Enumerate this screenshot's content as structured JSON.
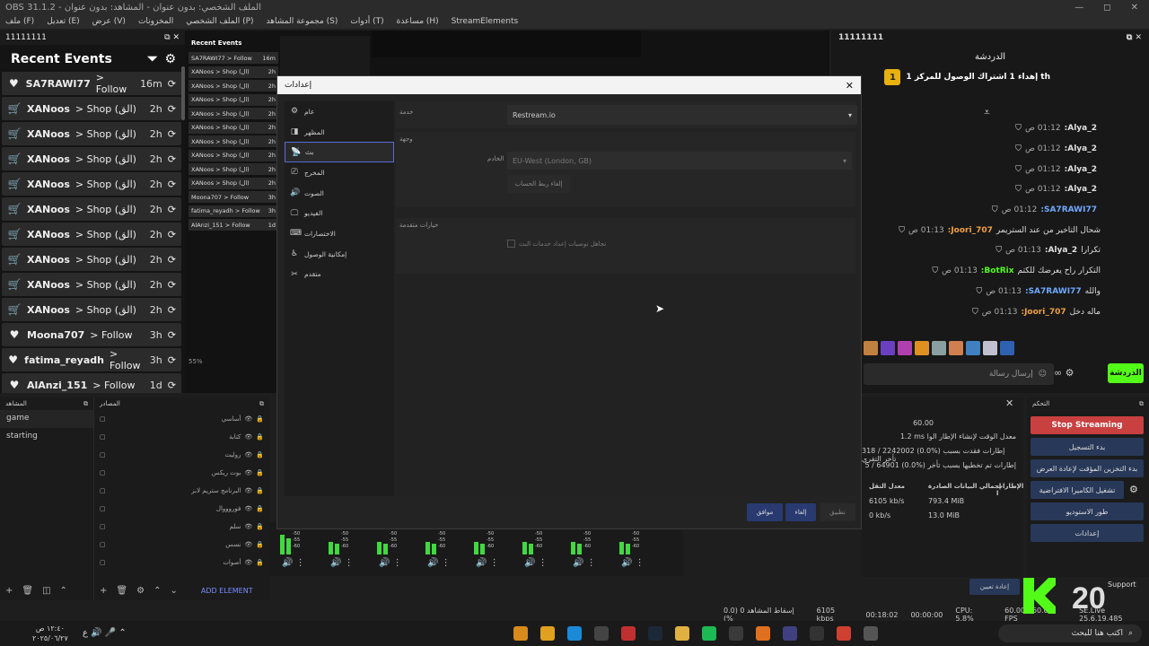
{
  "window": {
    "title": "OBS 31.1.2 - الملف الشخصي: بدون عنوان - المشاهد: بدون عنوان",
    "controls": [
      "—",
      "◻",
      "✕"
    ]
  },
  "menu": [
    "ملف (F)",
    "تعديل (E)",
    "عرض (V)",
    "المخزونات",
    "الملف الشخصي (P)",
    "مجموعة المشاهد (S)",
    "أدوات (T)",
    "مساعدة (H)",
    "StreamElements"
  ],
  "events_dock": {
    "tab_title": "11111111",
    "heading": "Recent Events",
    "rows": [
      {
        "name": "SA7RAWI77",
        "action": "> Follow",
        "time": "16m",
        "icon": "heart-icon"
      },
      {
        "name": "XANoos",
        "action": "> Shop (الق)",
        "time": "2h",
        "icon": "cart-icon"
      },
      {
        "name": "XANoos",
        "action": "> Shop (الق)",
        "time": "2h",
        "icon": "cart-icon"
      },
      {
        "name": "XANoos",
        "action": "> Shop (الق)",
        "time": "2h",
        "icon": "cart-icon"
      },
      {
        "name": "XANoos",
        "action": "> Shop (الق)",
        "time": "2h",
        "icon": "cart-icon"
      },
      {
        "name": "XANoos",
        "action": "> Shop (الق)",
        "time": "2h",
        "icon": "cart-icon"
      },
      {
        "name": "XANoos",
        "action": "> Shop (الق)",
        "time": "2h",
        "icon": "cart-icon"
      },
      {
        "name": "XANoos",
        "action": "> Shop (الق)",
        "time": "2h",
        "icon": "cart-icon"
      },
      {
        "name": "XANoos",
        "action": "> Shop (الق)",
        "time": "2h",
        "icon": "cart-icon"
      },
      {
        "name": "XANoos",
        "action": "> Shop (الق)",
        "time": "2h",
        "icon": "cart-icon"
      },
      {
        "name": "Moona707",
        "action": "> Follow",
        "time": "3h",
        "icon": "heart-icon"
      },
      {
        "name": "fatima_reyadh",
        "action": "> Follow",
        "time": "3h",
        "icon": "heart-icon"
      },
      {
        "name": "AlAnzi_151",
        "action": "> Follow",
        "time": "1d",
        "icon": "heart-icon"
      }
    ]
  },
  "preview": {
    "mini_title": "Recent Events",
    "mini_rows": [
      {
        "name": "SA7RAWI77 > Follow",
        "time": "16m"
      },
      {
        "name": "XANoos > Shop (ال)",
        "time": "2h"
      },
      {
        "name": "XANoos > Shop (ال)",
        "time": "2h"
      },
      {
        "name": "XANoos > Shop (ال)",
        "time": "2h"
      },
      {
        "name": "XANoos > Shop (ال)",
        "time": "2h"
      },
      {
        "name": "XANoos > Shop (ال)",
        "time": "2h"
      },
      {
        "name": "XANoos > Shop (ال)",
        "time": "2h"
      },
      {
        "name": "XANoos > Shop (ال)",
        "time": "2h"
      },
      {
        "name": "XANoos > Shop (ال)",
        "time": "2h"
      },
      {
        "name": "XANoos > Shop (ال)",
        "time": "2h"
      },
      {
        "name": "Moona707 > Follow",
        "time": "3h"
      },
      {
        "name": "fatima_reyadh > Follow",
        "time": "3h"
      },
      {
        "name": "AlAnzi_151 > Follow",
        "time": "1d"
      }
    ],
    "zoom": "55%"
  },
  "chat": {
    "tab_title": "11111111",
    "title": "الدردشة",
    "pinned_rank": "1",
    "pinned_text": "إهداء 1 اشتراك الوصول للمركز 1 th",
    "messages": [
      {
        "time": "01:12 ص",
        "user": "Alya_2:",
        "text": "",
        "color": "#e0e0e0"
      },
      {
        "time": "01:12 ص",
        "user": "Alya_2:",
        "text": "",
        "color": "#e0e0e0"
      },
      {
        "time": "01:12 ص",
        "user": "Alya_2:",
        "text": "",
        "color": "#e0e0e0"
      },
      {
        "time": "01:12 ص",
        "user": "Alya_2:",
        "text": "",
        "color": "#e0e0e0"
      },
      {
        "time": "01:12 ص",
        "user": "SA7RAWI77:",
        "text": "",
        "color": "#6fa8ff"
      },
      {
        "time": "01:13 ص",
        "user": "Joori_707:",
        "text": "شحال التاخير من عند الستريمر",
        "color": "#f0a040"
      },
      {
        "time": "01:13 ص",
        "user": "Alya_2:",
        "text": "تكرارا",
        "color": "#e0e0e0"
      },
      {
        "time": "01:13 ص",
        "user": "BotRix:",
        "text": "التكرار راح يعرضك للكتم",
        "color": "#53fc18"
      },
      {
        "time": "01:13 ص",
        "user": "SA7RAWI77:",
        "text": "والله",
        "color": "#6fa8ff"
      },
      {
        "time": "01:13 ص",
        "user": "Joori_707:",
        "text": "ماله دخل",
        "color": "#f0a040"
      }
    ],
    "input_placeholder": "إرسال رسالة",
    "send_label": "الدردشة"
  },
  "scenes": {
    "header": "المشاهد",
    "items": [
      "game",
      "starting"
    ]
  },
  "sources": {
    "header": "المصادر",
    "items": [
      "أساسي",
      "كتابة",
      "روليت",
      "بوت ريكس",
      "البرنامج ستريم لابز",
      "فوروووال",
      "سلم",
      "نسس",
      "أصوات"
    ],
    "add_label": "ADD ELEMENT"
  },
  "stats": {
    "fps": "60.00",
    "render_time": "1.2 ms",
    "missed": "318 / 2242002 (0.0%)",
    "skipped": "5 / 64901 (0.0%)",
    "col_total": "إجمالي البيانات الصادرة",
    "col_rate": "معدل النقل",
    "col_frames": "الإطارات ا",
    "total_1": "793.4 MiB",
    "rate_1": "6105 kb/s",
    "total_2": "13.0 MiB",
    "rate_2": "0 kb/s",
    "label_render": "معدل الوقت لإنشاء الإطار الوا",
    "label_missed": "إطارات فقدت بسبب تأخر التقري",
    "label_skipped": "إطارات تم تخطيها بسبب تأخر"
  },
  "controls": {
    "header": "التحكم",
    "stop": "Stop Streaming",
    "record": "بدء التسجيل",
    "replay": "بدء التخزين المؤقت لإعادة العرض",
    "vcam": "تشغيل الكاميرا الافتراضية",
    "studio": "طور الاستوديو",
    "settings": "إعدادات"
  },
  "dialog": {
    "title": "إعدادات",
    "sidebar": [
      {
        "label": "عام",
        "icon": "gear-icon"
      },
      {
        "label": "المظهر",
        "icon": "palette-icon"
      },
      {
        "label": "بث",
        "icon": "antenna-icon"
      },
      {
        "label": "المخرج",
        "icon": "output-icon"
      },
      {
        "label": "الصوت",
        "icon": "speaker-icon"
      },
      {
        "label": "الفيديو",
        "icon": "monitor-icon"
      },
      {
        "label": "الاختصارات",
        "icon": "keyboard-icon"
      },
      {
        "label": "إمكانية الوصول",
        "icon": "accessibility-icon"
      },
      {
        "label": "متقدم",
        "icon": "tools-icon"
      }
    ],
    "service_label": "خدمة",
    "service_value": "Restream.io",
    "destination_label": "وجهة",
    "server_label": "الخادم",
    "server_value": "EU-West (London, GB)",
    "disconnect_label": "إلغاء ربط الحساب",
    "advanced_label": "خيارات متقدمة",
    "ignore_label": "تجاهل توصيات إعداد خدمات البث",
    "ok": "موافق",
    "cancel": "إلغاء",
    "apply": "تطبيق"
  },
  "statusbar": {
    "dropped": "إسقاط المشاهد 0 (0.0 %)",
    "bitrate": "6105 kbps",
    "stream_time": "00:18:02",
    "rec_time": "00:00:00",
    "cpu": "CPU: 5.8%",
    "fps": "60.00 / 60.00 FPS",
    "se_live": "SE.Live 25.6.19.485"
  },
  "misc": {
    "restore_label": "إعادة تعيين",
    "support_label": "Support",
    "kick_logo_text": "20"
  },
  "taskbar": {
    "search_placeholder": "اكتب هنا للبحث",
    "time": "١٢:٤٠ ص",
    "date": "٢٠٢٥/٠٦/٢٧"
  }
}
